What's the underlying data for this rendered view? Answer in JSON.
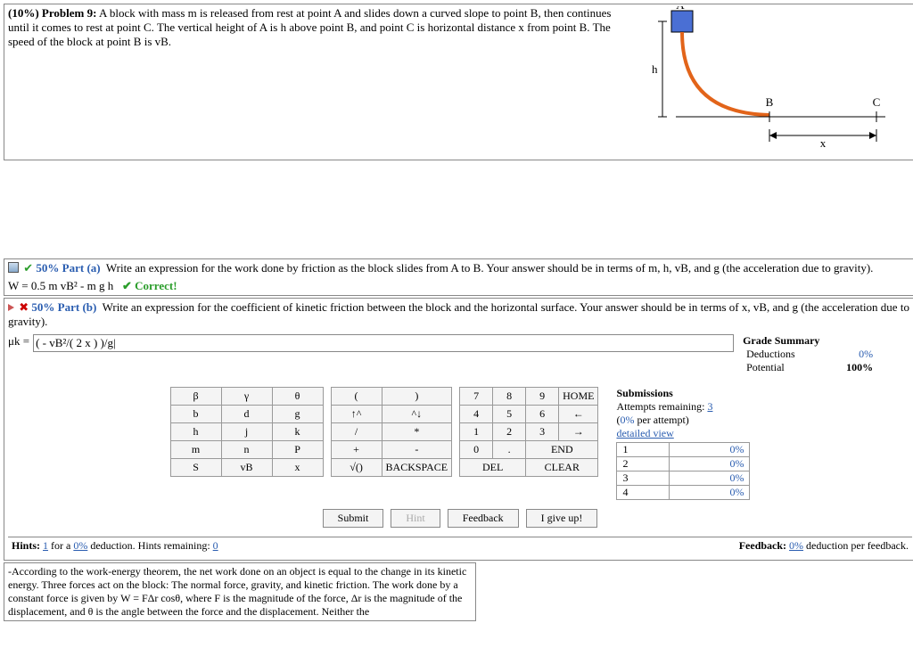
{
  "problem": {
    "weight": "(10%)",
    "label": "Problem 9:",
    "text": "A block with mass m is released from rest at point A and slides down a curved slope to point B, then continues until it comes to rest at point C. The vertical height of A is h above point B, and point C is horizontal distance x from point B. The speed of the block at point B is vB."
  },
  "diagram": {
    "A": "A",
    "B": "B",
    "C": "C",
    "h": "h",
    "x": "x"
  },
  "partA": {
    "pct": "50% Part (a)",
    "prompt": "Write an expression for the work done by friction as the block slides from A to B. Your answer should be in terms of m, h, vB, and g (the acceleration due to gravity).",
    "answer": "W = 0.5 m vB² - m g h",
    "status": "✔ Correct!"
  },
  "partB": {
    "pct": "50% Part (b)",
    "prompt": "Write an expression for the coefficient of kinetic friction between the block and the horizontal surface. Your answer should be in terms of x, vB, and g (the acceleration due to gravity).",
    "label": "μk =",
    "value": "( - vB²/( 2 x ) )/g|"
  },
  "grade": {
    "title": "Grade Summary",
    "deductions_lbl": "Deductions",
    "deductions_val": "0%",
    "potential_lbl": "Potential",
    "potential_val": "100%"
  },
  "subs": {
    "title": "Submissions",
    "remaining_lbl": "Attempts remaining:",
    "remaining_val": "3",
    "per": "(0% per attempt)",
    "detailed": "detailed view",
    "rows": [
      {
        "n": "1",
        "p": "0%"
      },
      {
        "n": "2",
        "p": "0%"
      },
      {
        "n": "3",
        "p": "0%"
      },
      {
        "n": "4",
        "p": "0%"
      }
    ]
  },
  "keypad": {
    "greek": [
      [
        "β",
        "γ",
        "θ"
      ],
      [
        "b",
        "d",
        "g"
      ],
      [
        "h",
        "j",
        "k"
      ],
      [
        "m",
        "n",
        "P"
      ],
      [
        "S",
        "vB",
        "x"
      ]
    ],
    "ops": [
      [
        "(",
        ")"
      ],
      [
        "↑^",
        "^↓"
      ],
      [
        "/",
        "*"
      ],
      [
        "+",
        "-"
      ],
      [
        "√()",
        "BACKSPACE"
      ]
    ],
    "nums": [
      [
        "7",
        "8",
        "9",
        "HOME"
      ],
      [
        "4",
        "5",
        "6",
        "←"
      ],
      [
        "1",
        "2",
        "3",
        "→"
      ],
      [
        "0",
        ".",
        "END"
      ],
      [
        "DEL",
        "CLEAR"
      ]
    ]
  },
  "actions": {
    "submit": "Submit",
    "hint": "Hint",
    "feedback": "Feedback",
    "giveup": "I give up!"
  },
  "hints": {
    "left_pre": "Hints: ",
    "left_count": "1",
    "left_mid": " for a ",
    "left_ded": "0%",
    "left_post": " deduction. Hints remaining: ",
    "left_rem": "0",
    "right_pre": "Feedback: ",
    "right_ded": "0%",
    "right_post": " deduction per feedback.",
    "body": "-According to the work-energy theorem, the net work done on an object is equal to the change in its kinetic energy. Three forces act on the block: The normal force, gravity, and kinetic friction. The work done by a constant force is given by W = FΔr cosθ, where F is the magnitude of the force, Δr is the magnitude of the displacement, and θ is the angle between the force and the displacement. Neither the"
  }
}
